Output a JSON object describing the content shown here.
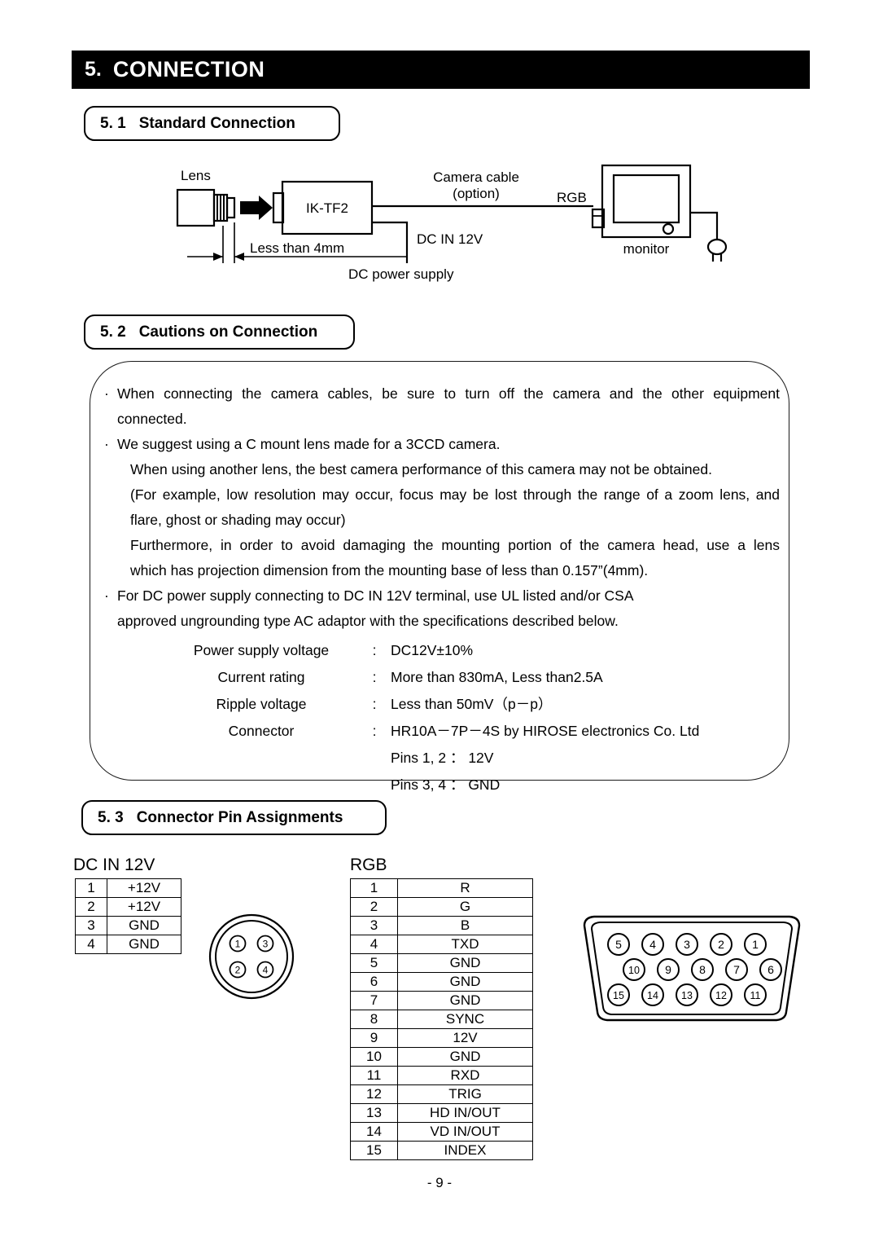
{
  "chapter": {
    "number": "5.",
    "title": "CONNECTION"
  },
  "sections": {
    "standard": {
      "number": "5. 1",
      "title": "Standard Connection"
    },
    "cautions": {
      "number": "5. 2",
      "title": "Cautions on Connection"
    },
    "pins": {
      "number": "5. 3",
      "title": "Connector Pin Assignments"
    }
  },
  "diagram": {
    "lens_label": "Lens",
    "camera_label": "IK-TF2",
    "dimension_label": "Less than 4mm",
    "cable_label_line1": "Camera cable",
    "cable_label_line2": "(option)",
    "dc_in_label": "DC IN 12V",
    "dc_supply_label": "DC power supply",
    "rgb_label": "RGB",
    "monitor_label": "monitor"
  },
  "cautions": {
    "bullet1": "When connecting the camera cables, be sure to turn off the camera and the other equipment",
    "bullet1_cont": "connected.",
    "bullet2": "We suggest using a C mount lens made for a 3CCD camera.",
    "bullet2_l1": "When using another lens, the best camera performance of this camera may not be obtained.",
    "bullet2_l2": "(For example, low resolution may occur, focus may be lost through the range of a zoom lens, and",
    "bullet2_l3": "flare, ghost or shading may occur)",
    "bullet2_l4": "Furthermore, in order to avoid damaging the mounting portion of the camera head, use a lens",
    "bullet2_l5": "which has projection dimension from the mounting base of less than 0.157”(4mm).",
    "bullet3": "For DC power supply connecting to DC IN 12V terminal, use UL listed and/or CSA",
    "bullet3_cont": "approved ungrounding type AC adaptor with the specifications described below.",
    "specs": [
      {
        "label": "Power supply voltage",
        "colon": ":",
        "value": "DC12V±10%"
      },
      {
        "label": "Current rating",
        "colon": ":",
        "value": "More than 830mA, Less than2.5A"
      },
      {
        "label": "Ripple voltage",
        "colon": ":",
        "value": "Less than 50mV（p－p）"
      },
      {
        "label": "Connector",
        "colon": ":",
        "value": "HR10A－7P－4S by HIROSE electronics Co. Ltd"
      },
      {
        "label": "",
        "colon": "",
        "value": "Pins 1, 2 ： 12V"
      },
      {
        "label": "",
        "colon": "",
        "value": "Pins 3, 4 ： GND"
      }
    ]
  },
  "pin_assignments": {
    "dcin": {
      "caption": "DC IN 12V",
      "rows": [
        {
          "no": "1",
          "signal": "+12V"
        },
        {
          "no": "2",
          "signal": "+12V"
        },
        {
          "no": "3",
          "signal": "GND"
        },
        {
          "no": "4",
          "signal": "GND"
        }
      ],
      "connector_pins": [
        "1",
        "3",
        "2",
        "4"
      ]
    },
    "rgb": {
      "caption": "RGB",
      "rows": [
        {
          "no": "1",
          "signal": "R"
        },
        {
          "no": "2",
          "signal": "G"
        },
        {
          "no": "3",
          "signal": "B"
        },
        {
          "no": "4",
          "signal": "TXD"
        },
        {
          "no": "5",
          "signal": "GND"
        },
        {
          "no": "6",
          "signal": "GND"
        },
        {
          "no": "7",
          "signal": "GND"
        },
        {
          "no": "8",
          "signal": "SYNC"
        },
        {
          "no": "9",
          "signal": "12V"
        },
        {
          "no": "10",
          "signal": "GND"
        },
        {
          "no": "11",
          "signal": "RXD"
        },
        {
          "no": "12",
          "signal": "TRIG"
        },
        {
          "no": "13",
          "signal": "HD IN/OUT"
        },
        {
          "no": "14",
          "signal": "VD IN/OUT"
        },
        {
          "no": "15",
          "signal": "INDEX"
        }
      ],
      "connector_rows": [
        [
          "5",
          "4",
          "3",
          "2",
          "1"
        ],
        [
          "10",
          "9",
          "8",
          "7",
          "6"
        ],
        [
          "15",
          "14",
          "13",
          "12",
          "11"
        ]
      ]
    }
  },
  "footer": {
    "page": "- 9 -"
  }
}
